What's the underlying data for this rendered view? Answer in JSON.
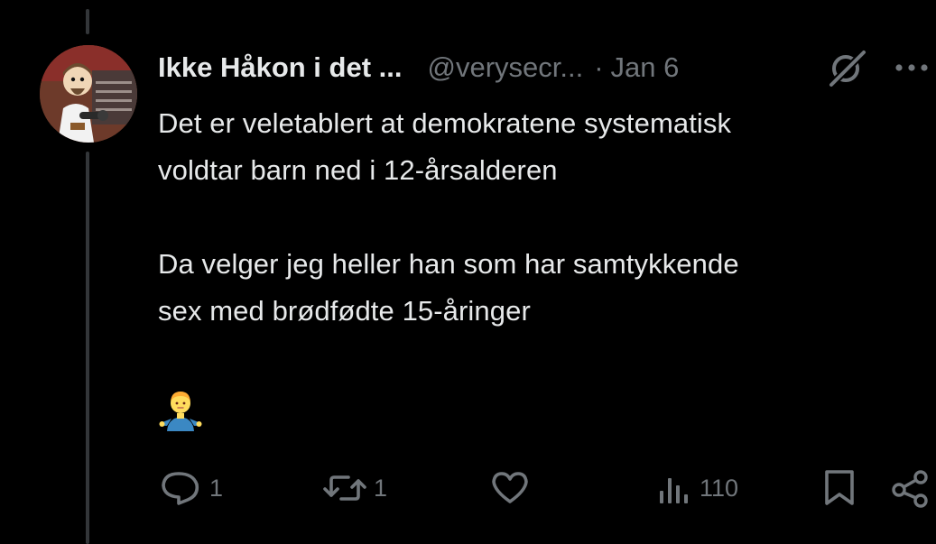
{
  "tweet": {
    "display_name": "Ikke Håkon i det ...",
    "handle": "@verysecr...",
    "separator": "·",
    "timestamp": "Jan 6",
    "text_lines": [
      "Det er veletablert at demokratene systematisk",
      "voldtar barn ned i 12-årsalderen",
      "Da velger jeg heller han som har samtykkende",
      "sex med brødfødte 15-åringer"
    ],
    "emoji": "person-shrugging"
  },
  "actions": {
    "reply_count": "1",
    "repost_count": "1",
    "like_count": "",
    "views_count": "110"
  },
  "icons": {
    "header": [
      "grok-icon",
      "more-icon"
    ],
    "actions": [
      "reply-icon",
      "repost-icon",
      "like-icon",
      "views-icon",
      "bookmark-icon",
      "share-icon"
    ]
  },
  "colors": {
    "background": "#000000",
    "primary_text": "#e7e9ea",
    "secondary_text": "#71767b",
    "thread_line": "#333639"
  }
}
